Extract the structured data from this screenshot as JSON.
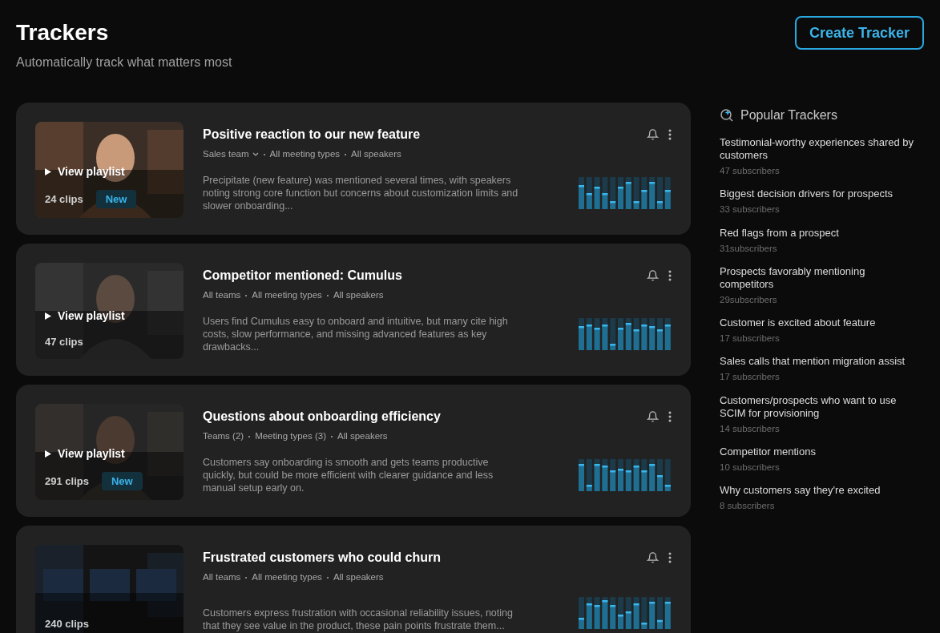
{
  "header": {
    "title": "Trackers",
    "subtitle": "Automatically track what matters most",
    "create_button": "Create Tracker"
  },
  "trackers": [
    {
      "title": "Positive reaction to our new feature",
      "filters": [
        {
          "label": "Sales team",
          "dropdown": true
        },
        {
          "label": "All meeting types",
          "dropdown": false
        },
        {
          "label": "All speakers",
          "dropdown": false
        }
      ],
      "summary": "Precipitate (new feature) was mentioned several times, with speakers noting strong core function but concerns about customization limits and slower onboarding...",
      "playlist": "View playlist",
      "clips": "24 clips",
      "badge": "New"
    },
    {
      "title": "Competitor mentioned: Cumulus",
      "filters": [
        {
          "label": "All teams",
          "dropdown": false
        },
        {
          "label": "All meeting types",
          "dropdown": false
        },
        {
          "label": "All speakers",
          "dropdown": false
        }
      ],
      "summary": "Users find Cumulus easy to onboard and intuitive, but many cite high costs, slow performance, and missing advanced features as key drawbacks...",
      "playlist": "View playlist",
      "clips": "47 clips"
    },
    {
      "title": "Questions about onboarding efficiency",
      "filters": [
        {
          "label": "Teams (2)",
          "dropdown": false
        },
        {
          "label": "Meeting types (3)",
          "dropdown": false
        },
        {
          "label": "All speakers",
          "dropdown": false
        }
      ],
      "summary": "Customers say onboarding is smooth and gets teams productive quickly, but could be more efficient with clearer guidance and less manual setup early on.",
      "playlist": "View playlist",
      "clips": "291 clips",
      "badge": "New"
    },
    {
      "title": "Frustrated customers who could churn",
      "filters": [
        {
          "label": "All teams",
          "dropdown": false
        },
        {
          "label": "All meeting types",
          "dropdown": false
        },
        {
          "label": "All speakers",
          "dropdown": false
        }
      ],
      "summary": "Customers express frustration with occasional reliability issues, noting that they see value in the product, these pain points frustrate them...",
      "clips": "240 clips"
    }
  ],
  "popular": {
    "title": "Popular Trackers",
    "items": [
      {
        "name": "Testimonial-worthy experiences shared by customers",
        "subscribers": "47 subscribers"
      },
      {
        "name": "Biggest decision drivers for prospects",
        "subscribers": "33 subscribers"
      },
      {
        "name": "Red flags from a prospect",
        "subscribers": "31subscribers"
      },
      {
        "name": "Prospects favorably mentioning competitors",
        "subscribers": "29subscribers"
      },
      {
        "name": "Customer is excited about feature",
        "subscribers": "17 subscribers"
      },
      {
        "name": "Sales calls that mention migration assist",
        "subscribers": "17 subscribers"
      },
      {
        "name": "Customers/prospects who want to use SCIM for provisioning",
        "subscribers": "14 subscribers"
      },
      {
        "name": "Competitor mentions",
        "subscribers": "10 subscribers"
      },
      {
        "name": "Why customers say they're excited",
        "subscribers": "8 subscribers"
      }
    ]
  }
}
